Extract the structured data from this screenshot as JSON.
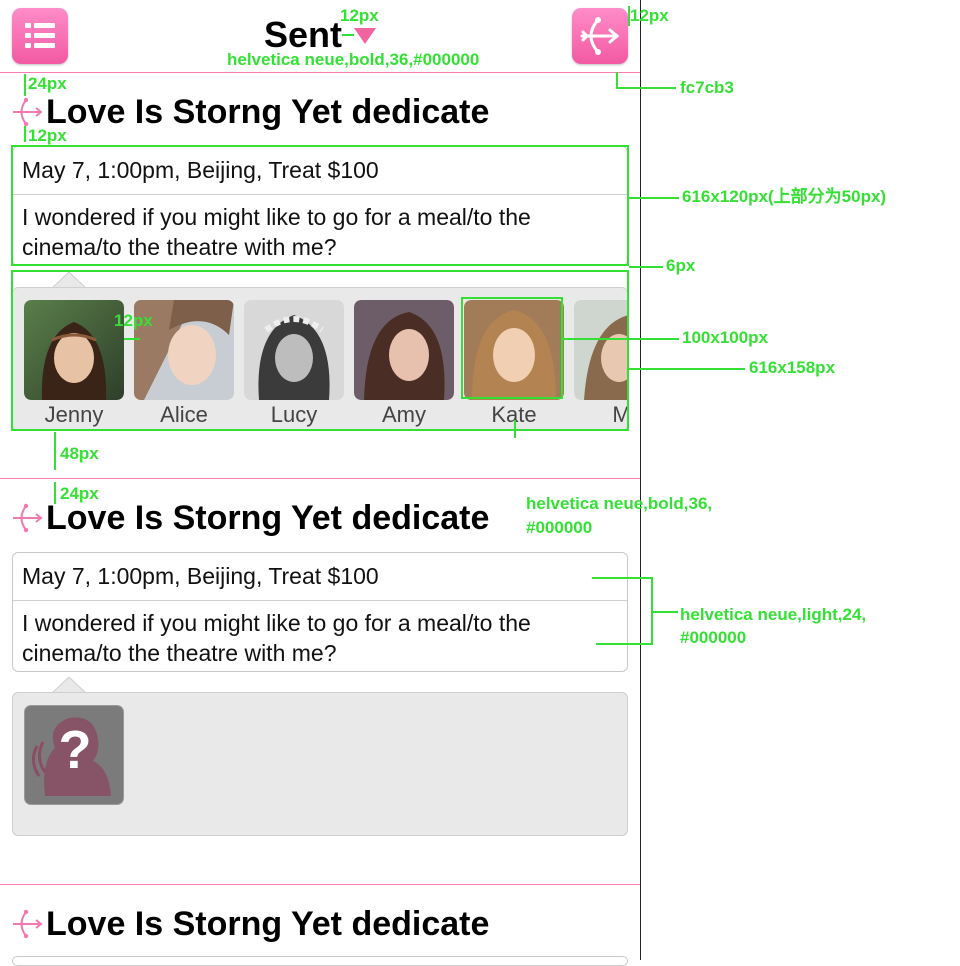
{
  "header": {
    "title": "Sent",
    "menu_icon": "list-icon",
    "action_icon": "cupid-arrow-icon",
    "dropdown_icon": "caret-down-icon",
    "accent_color": "#fc7cb3"
  },
  "sections": [
    {
      "title": "Love Is Storng Yet dedicate",
      "event": "May 7, 1:00pm, Beijing, Treat $100",
      "message": "I wondered if you might like to go for a meal/to the cinema/to the theatre with me?",
      "friends": [
        {
          "name": "Jenny"
        },
        {
          "name": "Alice"
        },
        {
          "name": "Lucy"
        },
        {
          "name": "Amy"
        },
        {
          "name": "Kate"
        },
        {
          "name": "Mi"
        }
      ]
    },
    {
      "title": "Love Is Storng Yet dedicate",
      "event": "May 7, 1:00pm, Beijing, Treat $100",
      "message": "I wondered if you might like to go for a meal/to the cinema/to the theatre with me?",
      "placeholder_icon": "unknown-person-icon",
      "placeholder_glyph": "?"
    },
    {
      "title": "Love Is Storng Yet dedicate"
    }
  ],
  "annotations": {
    "a1": "12px",
    "a2": "12px",
    "a3": "helvetica neue,bold,36,#000000",
    "a4": "fc7cb3",
    "a5": "24px",
    "a6": "12px",
    "a7": "616x120px(上部分为50px)",
    "a8": "6px",
    "a9": "12px",
    "a10": "100x100px",
    "a11": "616x158px",
    "a12": "48px",
    "a13": "24px",
    "a14_line1": "helvetica neue,bold,36,",
    "a14_line2": "#000000",
    "a15_line1": "helvetica neue,light,24,",
    "a15_line2": "#000000"
  }
}
